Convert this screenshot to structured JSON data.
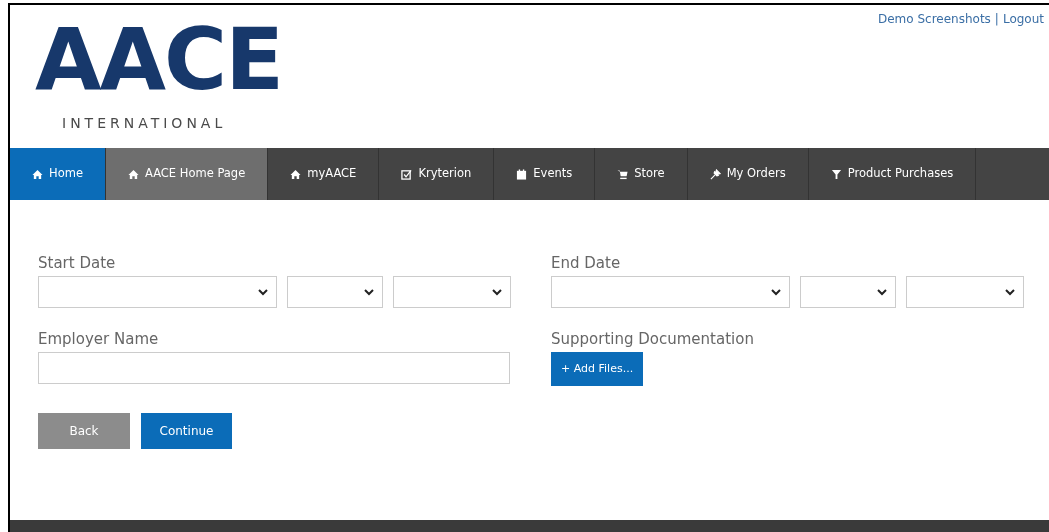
{
  "header": {
    "logo": {
      "name": "AACE",
      "subtitle": "INTERNATIONAL"
    },
    "top_links": [
      {
        "label": "Demo Screenshots"
      },
      {
        "label": "Logout"
      }
    ],
    "separator": "|"
  },
  "nav": [
    {
      "label": "Home",
      "selected": true,
      "hovered": false
    },
    {
      "label": "AACE Home Page",
      "selected": false,
      "hovered": true
    },
    {
      "label": "myAACE",
      "selected": false,
      "hovered": false
    },
    {
      "label": "Kryterion",
      "selected": false,
      "hovered": false
    },
    {
      "label": "Events",
      "selected": false,
      "hovered": false
    },
    {
      "label": "Store",
      "selected": false,
      "hovered": false
    },
    {
      "label": "My Orders",
      "selected": false,
      "hovered": false
    },
    {
      "label": "Product Purchases",
      "selected": false,
      "hovered": false
    }
  ],
  "form": {
    "start_date": {
      "label": "Start Date",
      "selects": [
        {
          "kind": "wide"
        },
        {
          "kind": "narrow"
        },
        {
          "kind": "medium"
        }
      ]
    },
    "end_date": {
      "label": "End Date",
      "selects": [
        {
          "kind": "wide"
        },
        {
          "kind": "narrow"
        },
        {
          "kind": "medium"
        }
      ]
    },
    "employer_name": {
      "label": "Employer Name"
    },
    "supporting_documentation": {
      "label": "Supporting Documentation",
      "button": "+ Add Files..."
    },
    "buttons": [
      {
        "label": "Back",
        "kind": "secondary"
      },
      {
        "label": "Continue",
        "kind": "primary"
      }
    ]
  }
}
